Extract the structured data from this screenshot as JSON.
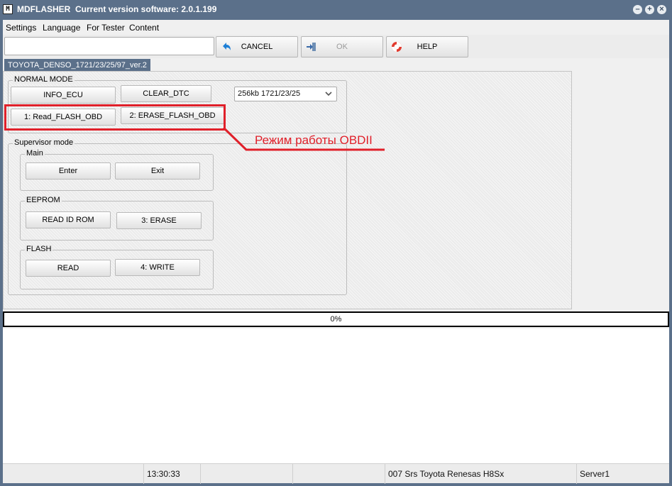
{
  "window": {
    "title": "MDFLASHER  Current version software: 2.0.1.199",
    "app_icon": "M"
  },
  "menu": [
    "Settings",
    "Language",
    "For Tester",
    "Content"
  ],
  "toolbar": {
    "input_value": "",
    "cancel_label": "CANCEL",
    "ok_label": "OK",
    "help_label": "HELP"
  },
  "tab": {
    "label": "TOYOTA_DENSO_1721/23/25/97_ver.2"
  },
  "normal_mode": {
    "title": "NORMAL MODE",
    "info_ecu": "INFO_ECU",
    "clear_dtc": "CLEAR_DTC",
    "combo_value": "256kb 1721/23/25",
    "read_flash_obd": "1: Read_FLASH_OBD",
    "erase_flash_obd": "2: ERASE_FLASH_OBD"
  },
  "annotation": {
    "text": "Режим работы OBDII",
    "color": "#e0202a"
  },
  "supervisor": {
    "title": "Supervisor mode",
    "main": {
      "title": "Main",
      "enter": "Enter",
      "exit": "Exit"
    },
    "eeprom": {
      "title": "EEPROM",
      "read_id_rom": "READ ID ROM",
      "erase": "3: ERASE"
    },
    "flash": {
      "title": "FLASH",
      "read": "READ",
      "write": "4: WRITE"
    }
  },
  "progress": {
    "text": "0%",
    "value": 0
  },
  "status": {
    "time": "13:30:33",
    "device": "007 Srs Toyota Renesas H8Sx",
    "server": "Server1"
  },
  "colors": {
    "titlebar": "#5b708a",
    "accent": "#e0202a"
  }
}
